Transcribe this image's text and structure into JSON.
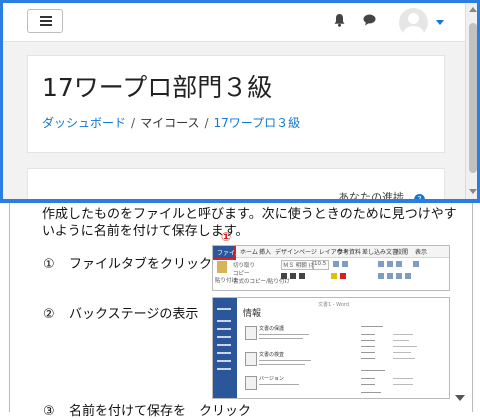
{
  "navbar": {
    "menu_icon": "hamburger-icon",
    "notifications_icon": "bell-icon",
    "messages_icon": "chat-bubble-icon",
    "user_avatar_icon": "avatar-icon",
    "user_menu_icon": "caret-down-icon"
  },
  "header": {
    "title": "17ワープロ部門３級",
    "breadcrumbs": [
      "ダッシュボード",
      "マイコース",
      "17ワープロ３級"
    ],
    "separator": "/"
  },
  "content": {
    "progress_label": "あなたの進捗",
    "help_icon": "question-icon"
  },
  "document": {
    "paragraph": "作成したものをファイルと呼びます。次に使うときのために見つけやすいように名前を付けて保存します。",
    "step1": {
      "num": "①",
      "text": "ファイルタブをクリック"
    },
    "step2": {
      "num": "②",
      "text": "バックステージの表示"
    },
    "step3": {
      "num": "③",
      "text": "名前を付けて保存を　クリック"
    },
    "marker": "①",
    "ribbon": {
      "tabs": [
        "ファイル",
        "ホーム",
        "挿入",
        "デザイン",
        "ページ レイアウト",
        "参考資料",
        "差し込み文書",
        "校閲",
        "表示"
      ],
      "font_name": "ＭＳ 明朝 (本文",
      "font_size": "10.5",
      "clipboard": "貼り付け",
      "cut": "切り取り",
      "copy": "コピー",
      "format_painter": "書式のコピー/貼り付け"
    },
    "backstage": {
      "title": "情報",
      "header": "文書1 - Word",
      "items": [
        "文書の保護",
        "文書の検査",
        "バージョン"
      ]
    }
  },
  "colors": {
    "accent": "#1177d1",
    "frame": "#2a7de1",
    "word_blue": "#2b579a",
    "marker_red": "#d3202a"
  }
}
